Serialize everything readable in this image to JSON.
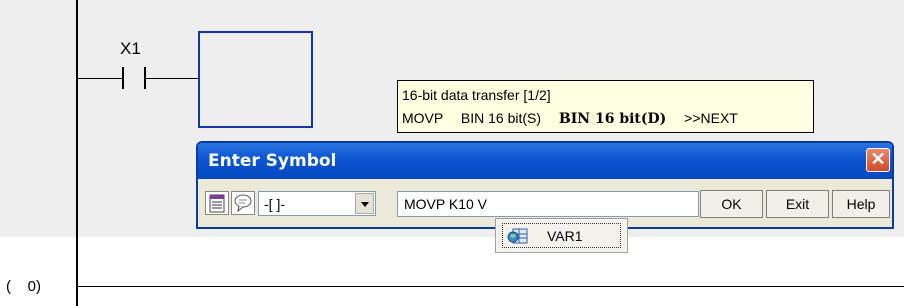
{
  "ladder": {
    "contact_label": "X1",
    "step_label": "(    0)"
  },
  "tooltip": {
    "line1": "16-bit data transfer [1/2]",
    "instruction": "MOVP",
    "arg1": "BIN 16 bit(S)",
    "arg2": "BIN 16 bit(D)",
    "next": ">>NEXT"
  },
  "dialog": {
    "title": "Enter Symbol",
    "close_glyph": "✕",
    "instruction_type": "-[ ]-",
    "input_value": "MOVP K10 V",
    "ok_label": "OK",
    "exit_label": "Exit",
    "help_label": "Help"
  },
  "popup": {
    "item_label": "VAR1"
  },
  "colors": {
    "titlebar": "#0a55d2",
    "cursor_box": "#1733a8",
    "tooltip_bg": "#ffffe1",
    "close_button": "#d14a28"
  },
  "icons": [
    "device-list-icon",
    "comment-icon",
    "dropdown-arrow-icon",
    "close-icon",
    "label-variable-icon"
  ]
}
